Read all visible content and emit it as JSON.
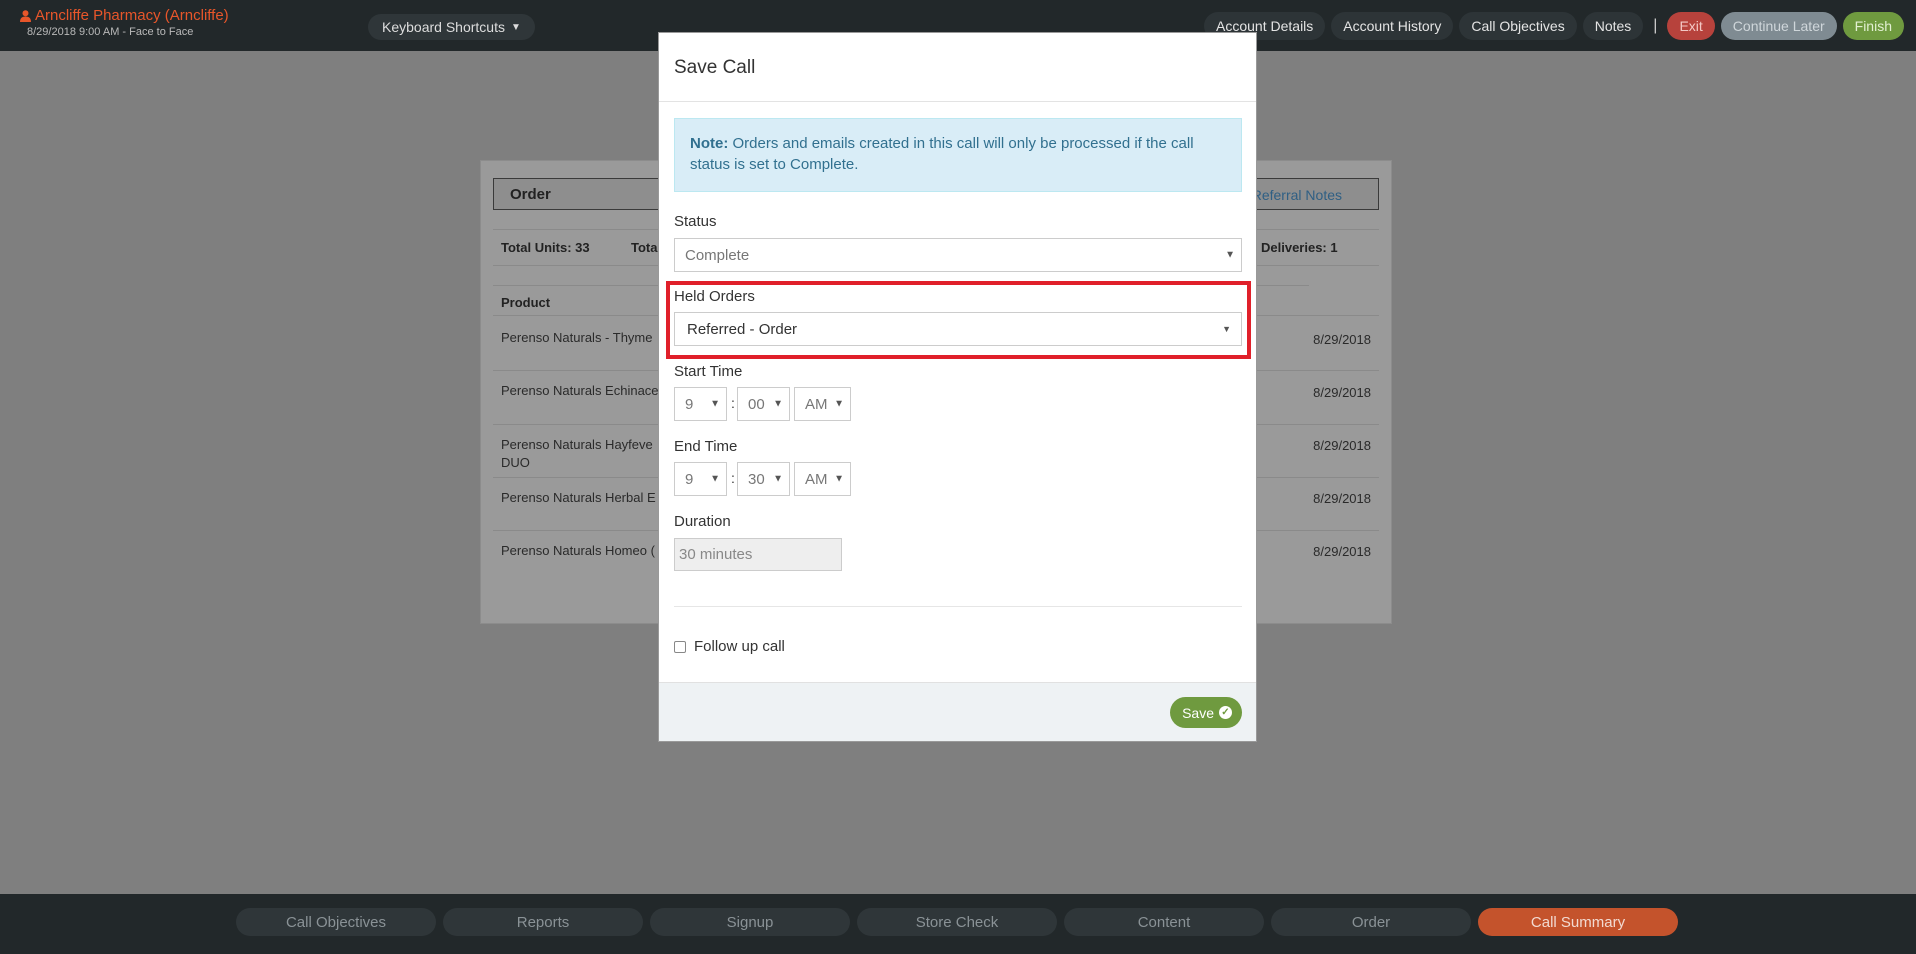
{
  "header": {
    "account_name": "Arncliffe Pharmacy (Arncliffe)",
    "account_sub": "8/29/2018 9:00 AM - Face to Face",
    "keyboard_shortcuts": "Keyboard Shortcuts",
    "nav": {
      "account_details": "Account Details",
      "account_history": "Account History",
      "call_objectives": "Call Objectives",
      "notes": "Notes",
      "separator": "|",
      "exit": "Exit",
      "continue_later": "Continue Later",
      "finish": "Finish"
    }
  },
  "order_panel": {
    "title": "Order",
    "referral_link": "Referral Notes",
    "total_units": "Total Units: 33",
    "total_partial": "Tota",
    "deliveries": "Deliveries: 1",
    "product_header": "Product",
    "rows": [
      {
        "product": "Perenso Naturals - Thyme",
        "date": "8/29/2018"
      },
      {
        "product": "Perenso Naturals Echinace",
        "date": "8/29/2018"
      },
      {
        "product": "Perenso Naturals Hayfeve DUO",
        "date": "8/29/2018"
      },
      {
        "product": "Perenso Naturals Herbal E",
        "date": "8/29/2018"
      },
      {
        "product": "Perenso Naturals Homeo (",
        "date": "8/29/2018"
      }
    ]
  },
  "modal": {
    "title": "Save Call",
    "note_label": "Note:",
    "note_text": " Orders and emails created in this call will only be processed if the call status is set to Complete.",
    "status_label": "Status",
    "status_value": "Complete",
    "held_orders_label": "Held Orders",
    "held_orders_value": "Referred - Order",
    "start_time_label": "Start Time",
    "start_hour": "9",
    "start_min": "00",
    "start_ampm": "AM",
    "end_time_label": "End Time",
    "end_hour": "9",
    "end_min": "30",
    "end_ampm": "AM",
    "time_sep": ":",
    "duration_label": "Duration",
    "duration_value": "30 minutes",
    "follow_up_label": "Follow up call",
    "save_label": "Save"
  },
  "bottom_nav": [
    "Call Objectives",
    "Reports",
    "Signup",
    "Store Check",
    "Content",
    "Order",
    "Call Summary"
  ],
  "colors": {
    "accent_orange": "#c4532c",
    "highlight_red": "#e0202a",
    "save_green": "#6f9a3f"
  }
}
